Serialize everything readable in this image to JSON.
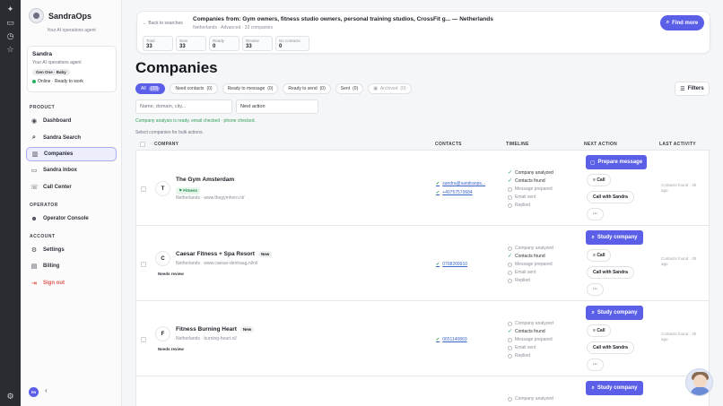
{
  "rail": {
    "icons": [
      "sparkle-icon",
      "inbox-icon",
      "clock-icon",
      "star-icon",
      "settings-icon"
    ]
  },
  "sidebar": {
    "brand": "SandraOps",
    "brand_sub": "Your AI operations agent",
    "agent": {
      "name": "Sandra",
      "role": "Your AI operations agent",
      "plan": "Gen One · Baby",
      "status": "Online · Ready to work"
    },
    "sections": {
      "product": "PRODUCT",
      "operator": "OPERATOR",
      "account": "ACCOUNT"
    },
    "items": [
      {
        "label": "Dashboard",
        "icon": "dashboard-icon"
      },
      {
        "label": "Sandra Search",
        "icon": "search-icon"
      },
      {
        "label": "Companies",
        "icon": "building-icon"
      },
      {
        "label": "Sandra Inbox",
        "icon": "inbox-icon"
      },
      {
        "label": "Call Center",
        "icon": "phone-icon"
      },
      {
        "label": "Operator Console",
        "icon": "users-icon"
      },
      {
        "label": "Settings",
        "icon": "gear-icon"
      },
      {
        "label": "Billing",
        "icon": "card-icon"
      },
      {
        "label": "Sign out",
        "icon": "logout-icon"
      }
    ],
    "lang": "EN"
  },
  "header": {
    "back": "← Back to searches",
    "title": "Companies from: Gym owners, fitness studio owners, personal training studios, CrossFit g... — Netherlands",
    "sub": "Netherlands · Advanced · 33 companies",
    "find_more": "Find more",
    "stats": [
      {
        "label": "Total",
        "value": "33"
      },
      {
        "label": "New",
        "value": "33"
      },
      {
        "label": "Ready",
        "value": "0"
      },
      {
        "label": "Review",
        "value": "33"
      },
      {
        "label": "No contacts",
        "value": "0"
      }
    ]
  },
  "page": {
    "title": "Companies",
    "filters": "Filters",
    "tabs": [
      {
        "label": "All",
        "count": "(33)"
      },
      {
        "label": "Need contacts",
        "count": "(0)"
      },
      {
        "label": "Ready to message",
        "count": "(0)"
      },
      {
        "label": "Ready to send",
        "count": "(0)"
      },
      {
        "label": "Sent",
        "count": "(0)"
      },
      {
        "label": "Archived",
        "count": "(0)"
      }
    ],
    "search_placeholder": "Name, domain, city...",
    "next_action_filter": "Next action",
    "ok_message": "Company analysis is ready. email checked · phone checked.",
    "hint": "Select companies for bulk actions."
  },
  "table": {
    "headers": {
      "company": "COMPANY",
      "contacts": "CONTACTS",
      "timeline": "TIMELINE",
      "next_action": "NEXT ACTION",
      "last_activity": "LAST ACTIVITY"
    },
    "rows": [
      {
        "initial": "T",
        "name": "The Gym Amsterdam",
        "tag": "Fitness",
        "location": "Netherlands · www.thegymhorn.nl/",
        "contacts": [
          "sandra@sandraops...",
          "+40757570684"
        ],
        "timeline": [
          "Company analyzed",
          "Contacts found",
          "Message prepared",
          "Email sent",
          "Replied"
        ],
        "primary": "Prepare message",
        "call": "Call",
        "call_sandra": "Call with Sandra",
        "more": "···",
        "last": "Contacts found · 3h ago"
      },
      {
        "initial": "C",
        "name": "Caesar Fitness + Spa Resort",
        "badge": "New",
        "location": "Netherlands · www.caesar-denhaag.nl/nl/",
        "review": "Needs review",
        "contacts": [
          "0708209910"
        ],
        "timeline": [
          "Company analyzed",
          "Contacts found",
          "Message prepared",
          "Email sent",
          "Replied"
        ],
        "primary": "Study company",
        "call": "Call",
        "call_sandra": "Call with Sandra",
        "more": "···",
        "last": "Contacts found · 3h ago"
      },
      {
        "initial": "F",
        "name": "Fitness Burning Heart",
        "badge": "New",
        "location": "Netherlands · burning-heart.nl/",
        "review": "Needs review",
        "contacts": [
          "0651140869"
        ],
        "timeline": [
          "Company analyzed",
          "Contacts found",
          "Message prepared",
          "Email sent",
          "Replied"
        ],
        "primary": "Study company",
        "call": "Call",
        "call_sandra": "Call with Sandra",
        "more": "···",
        "last": "Contacts found · 3h ago"
      },
      {
        "timeline": [
          "Company analyzed"
        ],
        "primary": "Study company"
      }
    ]
  }
}
